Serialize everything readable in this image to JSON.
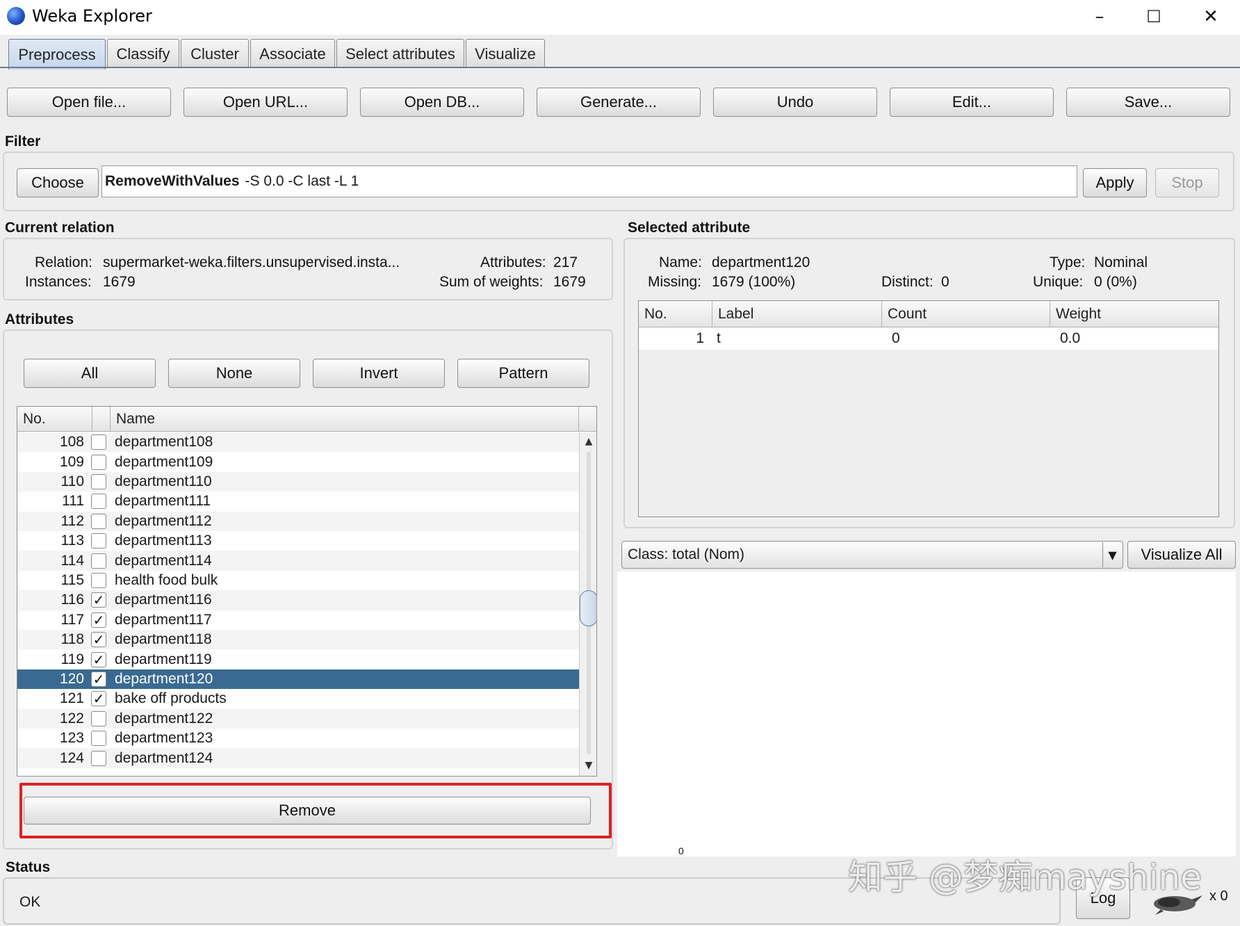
{
  "window": {
    "title": "Weka Explorer",
    "controls": {
      "minimize": "–",
      "maximize": "☐",
      "close": "✕"
    }
  },
  "tabs": [
    {
      "label": "Preprocess",
      "active": true
    },
    {
      "label": "Classify"
    },
    {
      "label": "Cluster"
    },
    {
      "label": "Associate"
    },
    {
      "label": "Select attributes"
    },
    {
      "label": "Visualize"
    }
  ],
  "toolbar": {
    "open_file": "Open file...",
    "open_url": "Open URL...",
    "open_db": "Open DB...",
    "generate": "Generate...",
    "undo": "Undo",
    "edit": "Edit...",
    "save": "Save..."
  },
  "filter": {
    "section_label": "Filter",
    "choose": "Choose",
    "name": "RemoveWithValues",
    "options": "-S 0.0 -C last -L 1",
    "apply": "Apply",
    "stop": "Stop"
  },
  "current_relation": {
    "section_label": "Current relation",
    "relation_label": "Relation:",
    "relation_value": "supermarket-weka.filters.unsupervised.insta...",
    "instances_label": "Instances:",
    "instances_value": "1679",
    "attributes_label": "Attributes:",
    "attributes_value": "217",
    "weights_label": "Sum of weights:",
    "weights_value": "1679"
  },
  "attributes": {
    "section_label": "Attributes",
    "buttons": {
      "all": "All",
      "none": "None",
      "invert": "Invert",
      "pattern": "Pattern"
    },
    "columns": {
      "no": "No.",
      "name": "Name"
    },
    "rows": [
      {
        "no": "108",
        "checked": false,
        "name": "department108"
      },
      {
        "no": "109",
        "checked": false,
        "name": "department109"
      },
      {
        "no": "110",
        "checked": false,
        "name": "department110"
      },
      {
        "no": "111",
        "checked": false,
        "name": "department111"
      },
      {
        "no": "112",
        "checked": false,
        "name": "department112"
      },
      {
        "no": "113",
        "checked": false,
        "name": "department113"
      },
      {
        "no": "114",
        "checked": false,
        "name": "department114"
      },
      {
        "no": "115",
        "checked": false,
        "name": "health food bulk"
      },
      {
        "no": "116",
        "checked": true,
        "name": "department116"
      },
      {
        "no": "117",
        "checked": true,
        "name": "department117"
      },
      {
        "no": "118",
        "checked": true,
        "name": "department118"
      },
      {
        "no": "119",
        "checked": true,
        "name": "department119"
      },
      {
        "no": "120",
        "checked": true,
        "name": "department120",
        "selected": true
      },
      {
        "no": "121",
        "checked": true,
        "name": "bake off products"
      },
      {
        "no": "122",
        "checked": false,
        "name": "department122"
      },
      {
        "no": "123",
        "checked": false,
        "name": "department123"
      },
      {
        "no": "124",
        "checked": false,
        "name": "department124"
      }
    ],
    "remove": "Remove",
    "checkmark": "✓",
    "scroll_up": "▲",
    "scroll_down": "▼"
  },
  "selected_attribute": {
    "section_label": "Selected attribute",
    "name_label": "Name:",
    "name_value": "department120",
    "type_label": "Type:",
    "type_value": "Nominal",
    "missing_label": "Missing:",
    "missing_value": "1679 (100%)",
    "distinct_label": "Distinct:",
    "distinct_value": "0",
    "unique_label": "Unique:",
    "unique_value": "0 (0%)",
    "columns": {
      "no": "No.",
      "label": "Label",
      "count": "Count",
      "weight": "Weight"
    },
    "rows": [
      {
        "no": "1",
        "label": "t",
        "count": "0",
        "weight": "0.0"
      }
    ]
  },
  "class_selector": {
    "value": "Class: total (Nom)",
    "arrow": "▼",
    "visualize_all": "Visualize All"
  },
  "histogram": {
    "bar_label": "0"
  },
  "status": {
    "section_label": "Status",
    "message": "OK",
    "log": "Log",
    "tasks": "x 0"
  },
  "watermark": "知乎 @梦痴mayshine"
}
